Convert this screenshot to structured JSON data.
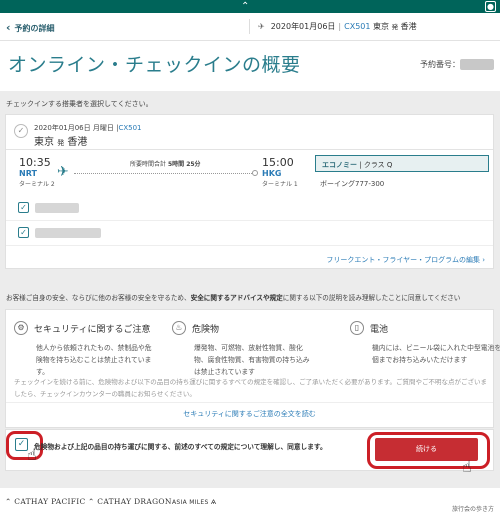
{
  "header": {
    "logo_icon": "cathay-brushwing-icon",
    "user_icon": "user-icon",
    "back_label": "予約の詳細",
    "flight_date": "2020年01月06日",
    "flight_no": "CX501",
    "from": "東京",
    "via": "発",
    "to": "香港"
  },
  "title": {
    "text": "オンライン・チェックインの概要",
    "booking_ref_label": "予約番号："
  },
  "passenger_select_label": "チェックインする搭乗者を選択してください。",
  "flight_card": {
    "date_line": "2020年01月06日 月曜日 |",
    "flight_no": "CX501",
    "route_from": "東京",
    "route_mid": "発",
    "route_to": "香港",
    "dep_time": "10:35",
    "dep_code": "NRT",
    "dep_terminal": "ターミナル 2",
    "duration_label": "所要時間合計",
    "duration_value": "5時間 25分",
    "arr_time": "15:00",
    "arr_code": "HKG",
    "arr_terminal": "ターミナル 1",
    "cabin_name": "エコノミー",
    "cabin_class": "| クラス Q",
    "aircraft": "ボーイング777-300",
    "ffp_link": "フリークエント・フライヤー・プログラムの編集",
    "passengers_checked": [
      true,
      true
    ]
  },
  "safety": {
    "intro_pre": "お客様ご自身の安全、ならびに他のお客様の安全を守るため、",
    "intro_bold": "安全に関するアドバイスや規定",
    "intro_post": "に関する以下の説明を読み理解したことに同意してください",
    "sections": [
      {
        "title": "セキュリティに関するご注意",
        "desc": "他人から依頼されたもの、禁制品や危険物を持ち込むことは禁止されています。"
      },
      {
        "title": "危険物",
        "desc": "爆発物、可燃物、放射性物質、酸化物、腐食性物質、有害物質の持ち込みは禁止されています"
      },
      {
        "title": "電池",
        "desc": "機内には、ビニール袋に入れた中型電池を2個までお持ち込みいただけます"
      }
    ],
    "warning": "チェックインを続ける前に、危険物および以下の品目の持ち運びに関するすべての規定を確認し、ご了承いただく必要があります。ご質問やご不明な点がございましたら、チェックインカウンターの職員にお知らせください。",
    "read_all": "セキュリティに関するご注意の全文を読む"
  },
  "agree": {
    "checked": true,
    "text": "危険物および上記の品目の持ち運びに関する、前述のすべての規定について理解し、同意します。",
    "continue_label": "続ける"
  },
  "footer": {
    "brand1": "CATHAY PACIFIC",
    "brand2": "CATHAY DRAGON",
    "brand3": "ASIA MILES",
    "right_text": "旅行会の歩き方"
  },
  "colors": {
    "brand_green": "#00645a",
    "accent_teal": "#2a7d8c",
    "link_blue": "#2a7bb6",
    "button_red": "#c62d33",
    "highlight_red": "#cc1f26"
  }
}
